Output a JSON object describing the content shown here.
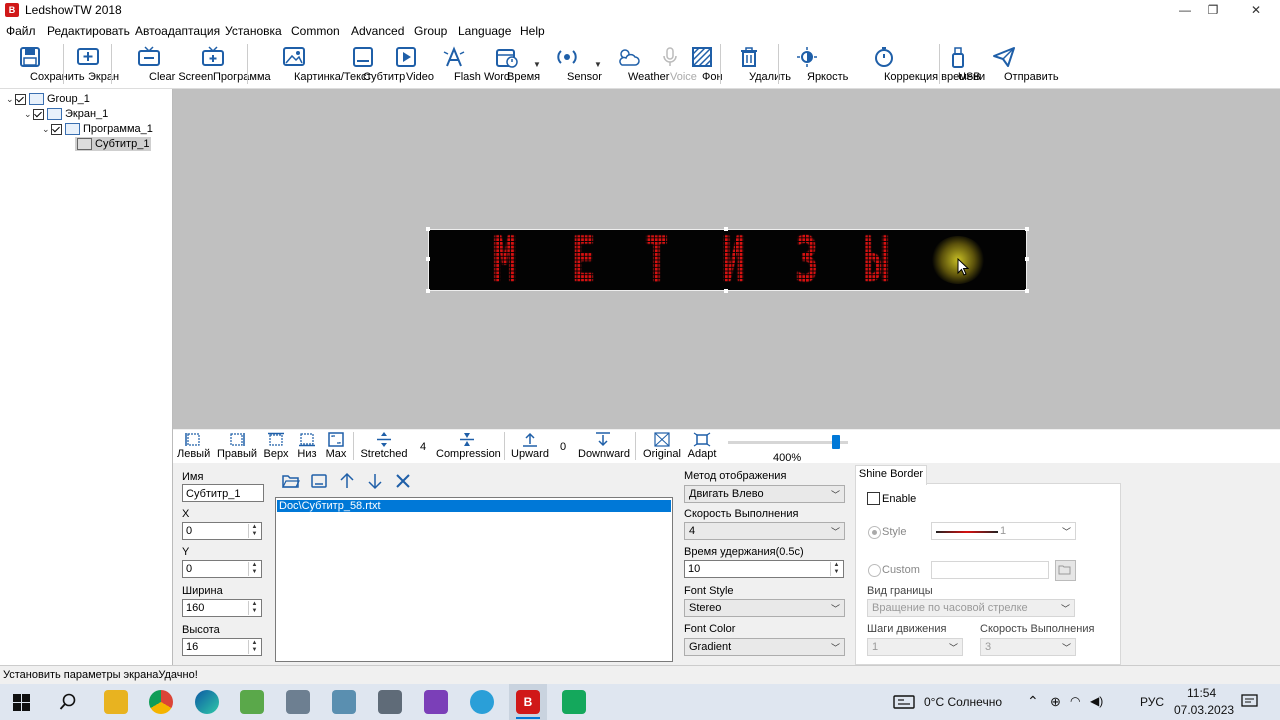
{
  "window": {
    "app_icon_text": "B",
    "title": "LedshowTW 2018",
    "controls": [
      "—",
      "❐",
      "✕"
    ]
  },
  "menu": [
    "Файл",
    "Редактировать",
    "Автоадаптация",
    "Установка",
    "Common",
    "Advanced",
    "Group",
    "Language",
    "Help"
  ],
  "toolbar": {
    "save": "Сохранить",
    "screen": "Экран",
    "clear_screen": "Clear Screen",
    "program": "Программа",
    "picture_text": "Картинка/Текст",
    "subtitle": "Субтитр",
    "video": "Video",
    "flash_word": "Flash Word",
    "time": "Время",
    "sensor": "Sensor",
    "weather": "Weather",
    "voice": "Voice",
    "background": "Фон",
    "delete": "Удалить",
    "brightness": "Яркость",
    "time_correction": "Коррекция времени",
    "usb": "USB",
    "send": "Отправить"
  },
  "tree": {
    "group": "Group_1",
    "screen": "Экран_1",
    "program": "Программа_1",
    "subtitle": "Субтитр_1"
  },
  "led_display": {
    "chars": [
      "М",
      "Е",
      "Т",
      "И",
      "З",
      "Ы"
    ],
    "color": "#d81010"
  },
  "edit_tools": {
    "left": "Левый",
    "right": "Правый",
    "top": "Верх",
    "bottom": "Низ",
    "max": "Max",
    "stretched": "Stretched",
    "stretched_value": "4",
    "compression": "Compression",
    "upward": "Upward",
    "upward_value": "0",
    "downward": "Downward",
    "original": "Original",
    "adapt": "Adapt",
    "zoom": "400%",
    "zoom_fraction": 0.93
  },
  "properties": {
    "name_label": "Имя",
    "name_value": "Субтитр_1",
    "x_label": "X",
    "x_value": "0",
    "y_label": "Y",
    "y_value": "0",
    "width_label": "Ширина",
    "width_value": "160",
    "height_label": "Высота",
    "height_value": "16"
  },
  "files": {
    "items": [
      "Doc\\Субтитр_58.rtxt"
    ]
  },
  "display_settings": {
    "method_label": "Метод отображения",
    "method_value": "Двигать Влево",
    "speed_label": "Скорость Выполнения",
    "speed_value": "4",
    "hold_label": "Время удержания(0.5c)",
    "hold_value": "10",
    "font_style_label": "Font Style",
    "font_style_value": "Stereo",
    "font_color_label": "Font Color",
    "font_color_value": "Gradient"
  },
  "shine_border": {
    "tab": "Shine Border",
    "enable": "Enable",
    "style": "Style",
    "style_value": "1",
    "custom": "Custom",
    "border_type_label": "Вид границы",
    "border_type_value": "Вращение по часовой стрелке",
    "steps_label": "Шаги движения",
    "steps_value": "1",
    "speed_label": "Скорость Выполнения",
    "speed_value": "3"
  },
  "status": "Установить параметры экранаУдачно!",
  "taskbar": {
    "weather": "0°C  Солнечно",
    "language": "РУС",
    "time": "11:54",
    "date": "07.03.2023"
  },
  "colors": {
    "accent": "#0078d7",
    "led_red": "#d81010",
    "canvas": "#c0c0c0"
  }
}
